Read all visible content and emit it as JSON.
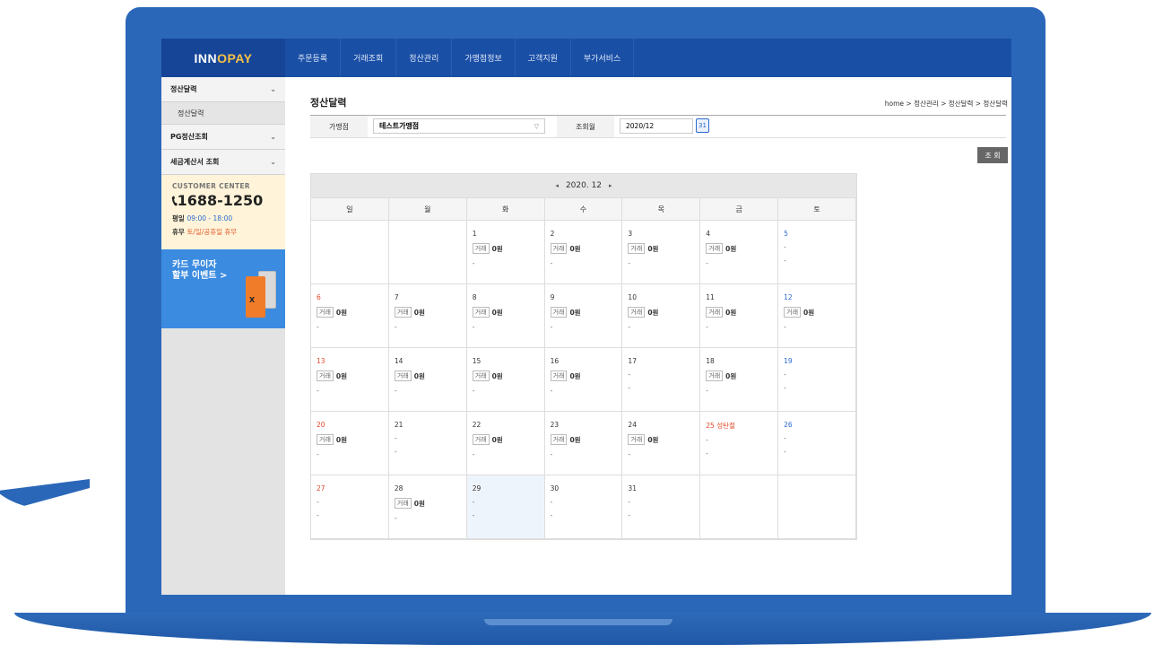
{
  "nav": {
    "logo_prefix": "INN",
    "logo_o": "O",
    "logo_suffix": "PAY",
    "menu": [
      "주문등록",
      "거래조회",
      "정산관리",
      "가맹점정보",
      "고객지원",
      "부가서비스"
    ]
  },
  "sidebar": {
    "items": [
      {
        "label": "정산달력",
        "sub": [
          "정산달력"
        ]
      },
      {
        "label": "PG정산조회"
      },
      {
        "label": "세금계산서 조회"
      }
    ],
    "customer_center": {
      "title": "CUSTOMER CENTER",
      "phone": "1688-1250",
      "weekday_label": "평일",
      "weekday_hours": "09:00 - 18:00",
      "holiday_label": "휴무",
      "holiday_text": "토/일/공휴일 휴무"
    },
    "banner": {
      "text": "카드 무이자\n할부 이벤트  >",
      "card_mark": "X"
    }
  },
  "main": {
    "title": "정산달력",
    "breadcrumb": "home > 정산관리 > 정산달력 > 정산달력",
    "filter": {
      "merchant_label": "가맹점",
      "merchant_value": "테스트가맹점",
      "month_label": "조회월",
      "month_value": "2020/12",
      "calendar_icon_label": "31"
    },
    "search_button": "조 회",
    "calendar": {
      "month": "2020. 12",
      "prev": "◂",
      "next": "▸",
      "weekdays": [
        "일",
        "월",
        "화",
        "수",
        "목",
        "금",
        "토"
      ],
      "tx_tag": "거래",
      "weeks": [
        [
          null,
          null,
          {
            "day": "1",
            "amount": "0원"
          },
          {
            "day": "2",
            "amount": "0원"
          },
          {
            "day": "3",
            "amount": "0원"
          },
          {
            "day": "4",
            "amount": "0원"
          },
          {
            "day": "5",
            "amount": null,
            "sat": true
          }
        ],
        [
          {
            "day": "6",
            "amount": "0원",
            "sun": true
          },
          {
            "day": "7",
            "amount": "0원"
          },
          {
            "day": "8",
            "amount": "0원"
          },
          {
            "day": "9",
            "amount": "0원"
          },
          {
            "day": "10",
            "amount": "0원"
          },
          {
            "day": "11",
            "amount": "0원"
          },
          {
            "day": "12",
            "amount": "0원",
            "sat": true
          }
        ],
        [
          {
            "day": "13",
            "amount": "0원",
            "sun": true
          },
          {
            "day": "14",
            "amount": "0원"
          },
          {
            "day": "15",
            "amount": "0원"
          },
          {
            "day": "16",
            "amount": "0원"
          },
          {
            "day": "17",
            "amount": null
          },
          {
            "day": "18",
            "amount": "0원"
          },
          {
            "day": "19",
            "amount": null,
            "sat": true
          }
        ],
        [
          {
            "day": "20",
            "amount": "0원",
            "sun": true
          },
          {
            "day": "21",
            "amount": null
          },
          {
            "day": "22",
            "amount": "0원"
          },
          {
            "day": "23",
            "amount": "0원"
          },
          {
            "day": "24",
            "amount": "0원"
          },
          {
            "day": "25 성탄절",
            "amount": null,
            "holiday": true
          },
          {
            "day": "26",
            "amount": null,
            "sat": true
          }
        ],
        [
          {
            "day": "27",
            "amount": null,
            "sun": true
          },
          {
            "day": "28",
            "amount": "0원"
          },
          {
            "day": "29",
            "amount": null,
            "today": true
          },
          {
            "day": "30",
            "amount": null
          },
          {
            "day": "31",
            "amount": null
          },
          null,
          null
        ]
      ]
    }
  }
}
